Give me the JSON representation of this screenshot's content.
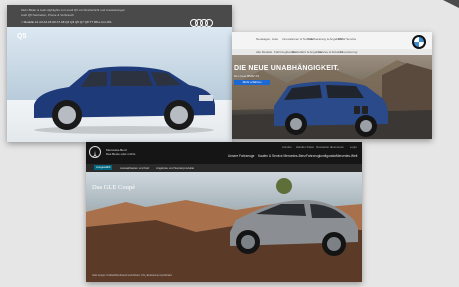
{
  "audi": {
    "top_text_1": "Mehr Bilder & Audi Highlights zum Audi Q5 mit Strahlerlicht und Ausstattungen",
    "top_text_2": "Audi Q5 Neuheiten, Preise & Verbrauch",
    "menu": "< Modelle    A1    A3    A4    A5    A6    A7    A8    Q2    Q3    Q5    Q7    Q8    TT    R8    e-tron    RS",
    "model": "Q5"
  },
  "bmw": {
    "nav_items": [
      "Neuwagen",
      "Auto",
      "Innovationen & Technik",
      "Kaufberatung & Angebote",
      "BMW Service"
    ],
    "nav2_items": [
      "Alle Modelle",
      "Fahrzeugberater",
      "Probefahrt & Angebote",
      "Service & Zubehör",
      "Finanzierung"
    ],
    "headline": "DIE NEUE UNABHÄNGIGKEIT.",
    "subline": "Der neue BMW X3.",
    "cta": "Mehr erfahren"
  },
  "mercedes": {
    "brand_line_1": "Mercedes-Benz",
    "brand_line_2": "Das Beste oder nichts",
    "nav_items": [
      "Unsere Fahrzeuge",
      "Kaufen & Service Mercedes-Benz",
      "Fahrzeugkonfigurator",
      "Mercedes-Welt"
    ],
    "util_items": [
      "Anrufen",
      "Händler finden",
      "Newsletter abonnieren",
      "Login"
    ],
    "tabs": [
      "Ausgewählt",
      "Auswahlseiten und Karl",
      "Angebote und Sonderprodukte"
    ],
    "model_name": "Das GLE Coupé",
    "legal": "GLE Coupé: Kraftstoffverbrauch kombiniert, CO₂-Emissionen kombiniert"
  },
  "colors": {
    "audi_blue": "#1f3a78",
    "bmw_blue": "#2a4a8a",
    "mercedes_grey": "#8b8f93",
    "mercedes_teal": "#00677f"
  }
}
